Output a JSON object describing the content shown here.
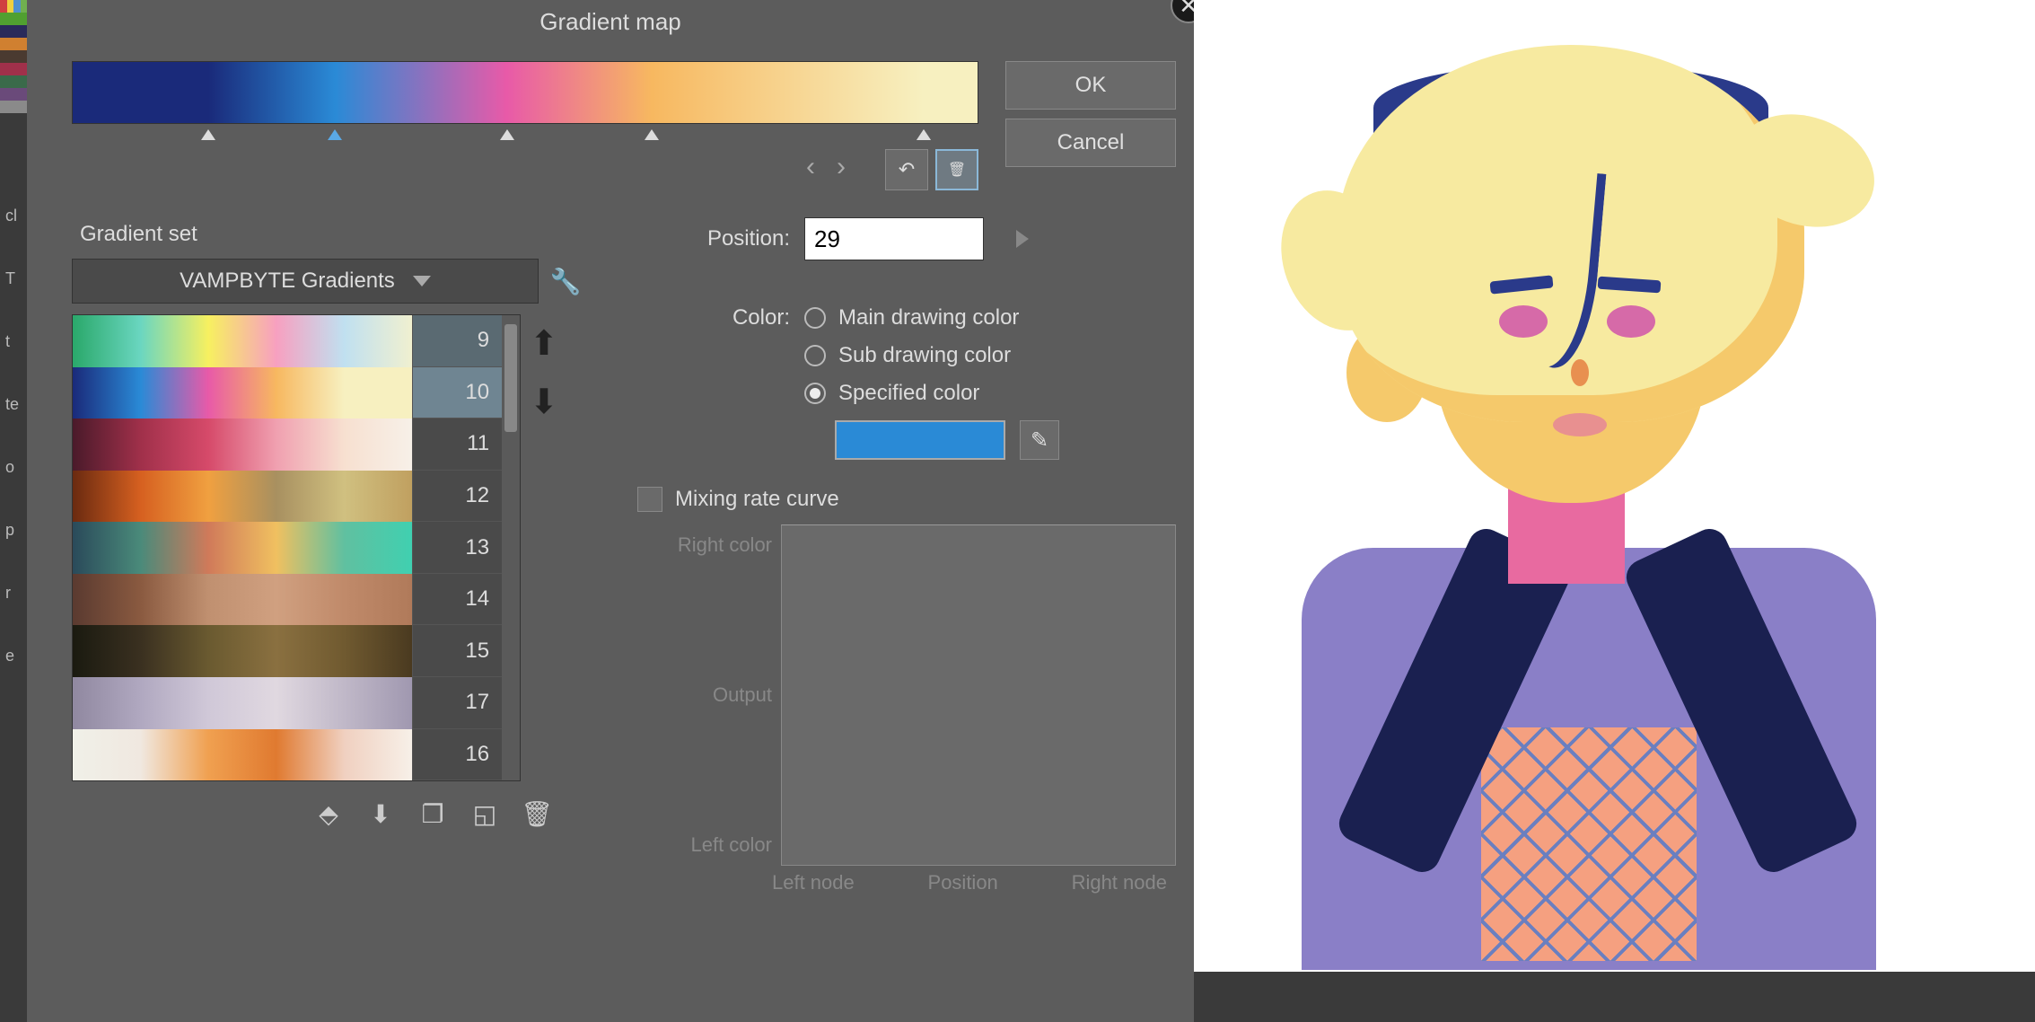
{
  "dialog": {
    "title": "Gradient map",
    "ok": "OK",
    "cancel": "Cancel",
    "gradient_stops": [
      {
        "pos": 0,
        "color": "#1a2a7a"
      },
      {
        "pos": 15,
        "color": "#1a2a7a"
      },
      {
        "pos": 29,
        "color": "#2a8ad6",
        "selected": true
      },
      {
        "pos": 48,
        "color": "#e85aa8"
      },
      {
        "pos": 64,
        "color": "#f7b860"
      },
      {
        "pos": 94,
        "color": "#f7f0c0"
      },
      {
        "pos": 100,
        "color": "#f7f0c0"
      }
    ],
    "position_label": "Position:",
    "position_value": "29",
    "color_label": "Color:",
    "color_options": {
      "main": "Main drawing color",
      "sub": "Sub drawing color",
      "spec": "Specified color"
    },
    "color_selected": "spec",
    "specified_color": "#2a8ad6",
    "mixing_label": "Mixing rate curve",
    "mixing_checked": false,
    "curve": {
      "y_top": "Right color",
      "y_mid": "Output",
      "y_bot": "Left color",
      "x_left": "Left node",
      "x_mid": "Position",
      "x_right": "Right node"
    }
  },
  "gradient_set": {
    "title": "Gradient set",
    "dropdown": "VAMPBYTE Gradients",
    "items": [
      {
        "num": "9",
        "colors": [
          "#2aa86a",
          "#6ad6c0",
          "#f7f060",
          "#f7a0c0",
          "#c0e0f0",
          "#f0f0d0"
        ]
      },
      {
        "num": "10",
        "colors": [
          "#1a2a7a",
          "#2a8ad6",
          "#e85aa8",
          "#f7b860",
          "#f7f0c0",
          "#f7f0c0"
        ],
        "selected": true
      },
      {
        "num": "11",
        "colors": [
          "#4a1a2a",
          "#a0304a",
          "#d64a6a",
          "#f0a0b0",
          "#f7e0d0",
          "#f7f0e8"
        ]
      },
      {
        "num": "12",
        "colors": [
          "#6a2a10",
          "#d66020",
          "#f0a040",
          "#a89060",
          "#d0c080",
          "#c0a060"
        ]
      },
      {
        "num": "13",
        "colors": [
          "#2a4a5a",
          "#4a8a7a",
          "#d07a5a",
          "#f0c060",
          "#60c0a0",
          "#40d0b0"
        ]
      },
      {
        "num": "14",
        "colors": [
          "#5a3a30",
          "#8a5a40",
          "#c09070",
          "#d0a080",
          "#c08a6a",
          "#b07a5a"
        ]
      },
      {
        "num": "15",
        "colors": [
          "#1a1a10",
          "#3a3020",
          "#6a5a30",
          "#8a7040",
          "#705a30",
          "#4a3a20"
        ]
      },
      {
        "num": "17",
        "colors": [
          "#9088a0",
          "#b0a8c0",
          "#d0c8d8",
          "#e0d8e0",
          "#c0b8c8",
          "#a098b0"
        ]
      },
      {
        "num": "16",
        "colors": [
          "#f0f0e8",
          "#f0e8e0",
          "#f0a050",
          "#e07a30",
          "#f0d0c0",
          "#f7f0e8"
        ]
      }
    ]
  },
  "icons": {
    "close": "✕",
    "reset": "↶",
    "trash": "🗑",
    "wrench": "🔧",
    "up": "▲",
    "down": "▼",
    "eyedropper": "✎",
    "nav_left": "‹",
    "nav_right": "›",
    "replace": "⬘",
    "import": "⬇",
    "duplicate": "❐",
    "new": "◱",
    "delete": "🗑"
  }
}
